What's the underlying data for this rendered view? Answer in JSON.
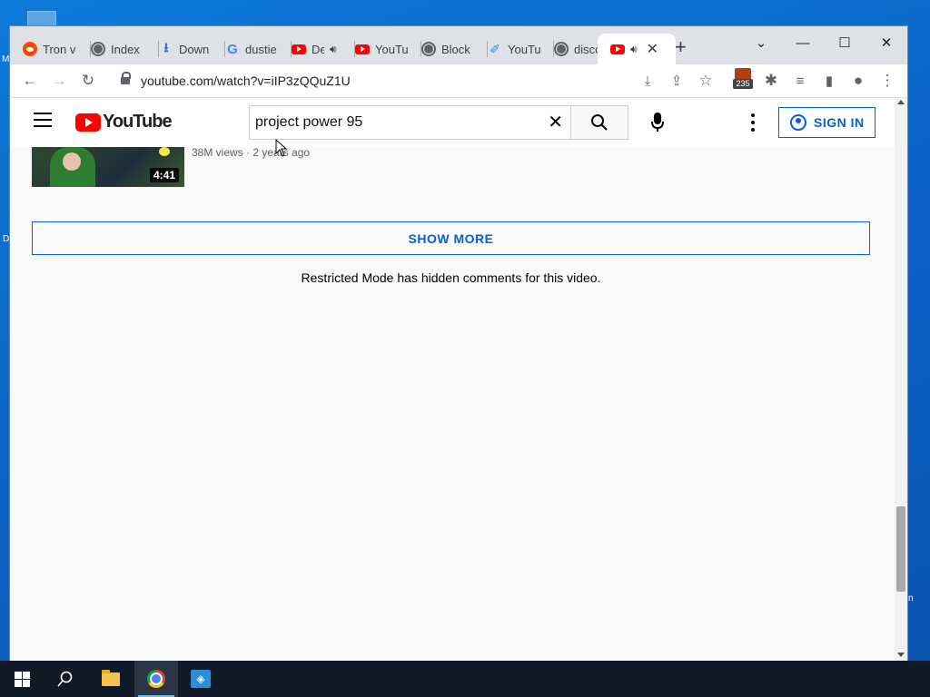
{
  "desktop": {
    "left_glyph_1": "M",
    "left_glyph_2": "D",
    "right_glyph": "n"
  },
  "browser": {
    "tabs": [
      {
        "label": "Tron v",
        "icon": "reddit-icon"
      },
      {
        "label": "Index",
        "icon": "globe-icon"
      },
      {
        "label": "Down",
        "icon": "download-icon"
      },
      {
        "label": "dustie",
        "icon": "google-icon"
      },
      {
        "label": "De",
        "icon": "youtube-icon",
        "audio": true
      },
      {
        "label": "YouTu",
        "icon": "youtube-icon"
      },
      {
        "label": "Block",
        "icon": "globe-icon"
      },
      {
        "label": "YouTu",
        "icon": "pin-icon"
      },
      {
        "label": "disco",
        "icon": "globe-icon"
      },
      {
        "label": "",
        "icon": "youtube-icon",
        "audio": true,
        "active": true
      }
    ],
    "url": "youtube.com/watch?v=iIP3zQQuZ1U",
    "extension_badge": "235"
  },
  "youtube": {
    "logo_text": "YouTube",
    "search": {
      "value": "project power 95",
      "placeholder": "Search"
    },
    "sign_in_label": "SIGN IN",
    "video": {
      "duration": "4:41",
      "meta": "38M views · 2 years ago"
    },
    "show_more_label": "SHOW MORE",
    "restricted_message": "Restricted Mode has hidden comments for this video."
  },
  "colors": {
    "accent": "#065fd4",
    "brand": "#ff0000",
    "tabstrip": "#dee1e6",
    "taskbar": "#101a26"
  }
}
